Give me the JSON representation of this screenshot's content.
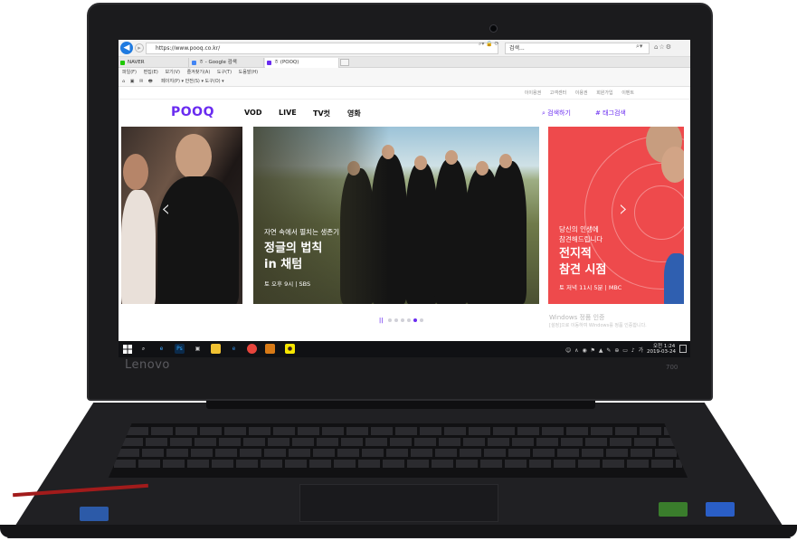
{
  "browser": {
    "url": "https://www.pooq.co.kr/",
    "search_placeholder": "검색...",
    "tabs": [
      {
        "label": "NAVER"
      },
      {
        "label": "ㅎ - Google 검색"
      },
      {
        "label": "ㅎ (POOQ)"
      }
    ],
    "menu": [
      "파일(F)",
      "편집(E)",
      "보기(V)",
      "즐겨찾기(A)",
      "도구(T)",
      "도움말(H)"
    ],
    "command_bar": "페이지(P) ▾  안전(S) ▾  도구(O) ▾"
  },
  "site": {
    "logo": "POOQ",
    "util_links": [
      "이이용권",
      "고객센터",
      "이용권",
      "회원가입",
      "이벤트"
    ],
    "nav": [
      "VOD",
      "LIVE",
      "TV컷",
      "영화"
    ],
    "search_label": "검색하기",
    "tag_search_label": "태그검색"
  },
  "carousel": {
    "center": {
      "subtitle": "자연 속에서 펼치는 생존기",
      "title_line1": "정글의 법칙",
      "title_line2": "in 채텀",
      "meta": "토 오후 9시 | SBS"
    },
    "right": {
      "subtitle_line1": "당신의 인생에",
      "subtitle_line2": "참견해드립니다",
      "title_line1": "전지적",
      "title_line2": "참견 시점",
      "meta": "토 저녁 11시 5분 | MBC",
      "accent": "#ee4a4c"
    },
    "dots_total": 6,
    "dot_active": 5
  },
  "watermark": {
    "line1": "Windows 정품 인증",
    "line2": "[설정]으로 이동하여 Windows를 정품 인증합니다."
  },
  "taskbar": {
    "time": "오전 1:24",
    "date": "2019-03-24"
  },
  "device": {
    "brand": "Lenovo",
    "model": "700"
  },
  "colors": {
    "brand_purple": "#6a2cf0",
    "taskbar": "#101114"
  }
}
